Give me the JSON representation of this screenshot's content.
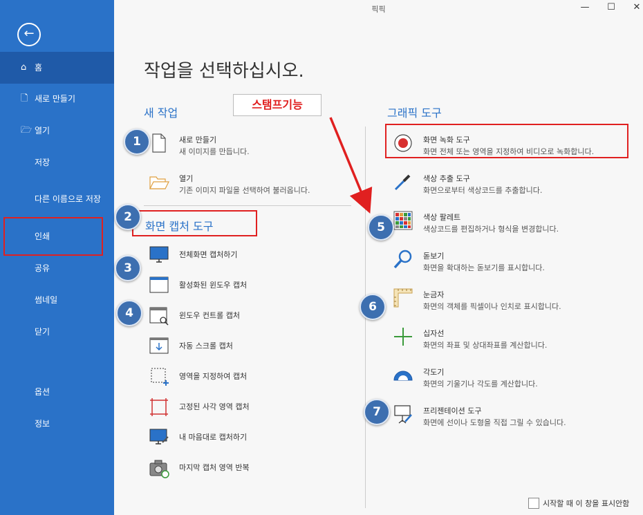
{
  "window": {
    "title": "픽픽",
    "minimize": "—",
    "maximize": "☐",
    "close": "✕"
  },
  "sidebar": {
    "back": "←",
    "items": [
      {
        "label": "홈",
        "icon": "⌂"
      },
      {
        "label": "새로 만들기",
        "icon": "🗋"
      },
      {
        "label": "열기",
        "icon": "🗁"
      },
      {
        "label": "저장"
      },
      {
        "label": "다른 이름으로 저장"
      },
      {
        "label": "인쇄"
      },
      {
        "label": "공유"
      },
      {
        "label": "썸네일"
      },
      {
        "label": "닫기"
      },
      {
        "label": "옵션"
      },
      {
        "label": "정보"
      }
    ]
  },
  "main": {
    "heading": "작업을 선택하십시오.",
    "new_task_title": "새 작업",
    "new_items": [
      {
        "title": "새로 만들기",
        "desc": "새 이미지를 만듭니다."
      },
      {
        "title": "열기",
        "desc": "기존 이미지 파일을 선택하여 불러옵니다."
      }
    ],
    "capture_title": "화면 캡처 도구",
    "capture_items": [
      "전체화면 캡처하기",
      "활성화된 윈도우 캡처",
      "윈도우 컨트롤 캡처",
      "자동 스크롤 캡처",
      "영역을 지정하여 캡처",
      "고정된 사각 영역 캡처",
      "내 마음대로 캡처하기",
      "마지막 캡처 영역 반복"
    ],
    "graphic_title": "그래픽 도구",
    "graphic_items": [
      {
        "title": "화면 녹화 도구",
        "desc": "화면 전체 또는 영역을 지정하여 비디오로 녹화합니다."
      },
      {
        "title": "색상 추출 도구",
        "desc": "화면으로부터 색상코드를 추출합니다."
      },
      {
        "title": "색상 팔레트",
        "desc": "색상코드를 편집하거나 형식을 변경합니다."
      },
      {
        "title": "돋보기",
        "desc": "화면을 확대하는 돋보기를 표시합니다."
      },
      {
        "title": "눈금자",
        "desc": "화면의 객체를 픽셀이나 인치로 표시합니다."
      },
      {
        "title": "십자선",
        "desc": "화면의 좌표 및 상대좌표를 계산합니다."
      },
      {
        "title": "각도기",
        "desc": "화면의 기울기나 각도를 계산합니다."
      },
      {
        "title": "프리젠테이션 도구",
        "desc": "화면에 선이나 도형을 직접 그릴 수 있습니다."
      }
    ],
    "startup_checkbox": "시작할 때 이 창을 표시안함"
  },
  "annotations": {
    "stamp_label": "스탬프기능",
    "badges": [
      "1",
      "2",
      "3",
      "4",
      "5",
      "6",
      "7"
    ],
    "accent": "#e02020"
  }
}
